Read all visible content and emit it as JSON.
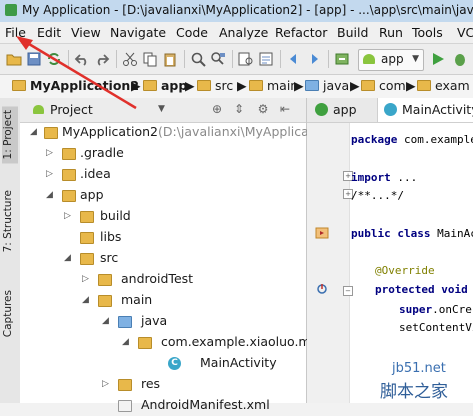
{
  "window": {
    "title": "My Application - [D:\\javalianxi\\MyApplication2] - [app] - ...\\app\\src\\main\\java\\"
  },
  "menu": [
    "File",
    "Edit",
    "View",
    "Navigate",
    "Code",
    "Analyze",
    "Refactor",
    "Build",
    "Run",
    "Tools",
    "VC"
  ],
  "toolbar": {
    "run_config": "app"
  },
  "breadcrumb": [
    "MyApplication2",
    "app",
    "src",
    "main",
    "java",
    "com",
    "exam"
  ],
  "tool_strip": {
    "project_tab": "1: Project",
    "structure_tab": "7: Structure",
    "captures_tab": "Captures"
  },
  "project_panel": {
    "view_selector": "Project",
    "tree": [
      {
        "label": "MyApplication2",
        "extra": "(D:\\javalianxi\\MyApplication"
      },
      {
        "label": ".gradle"
      },
      {
        "label": ".idea"
      },
      {
        "label": "app"
      },
      {
        "label": "build"
      },
      {
        "label": "libs"
      },
      {
        "label": "src"
      },
      {
        "label": "androidTest"
      },
      {
        "label": "main"
      },
      {
        "label": "java"
      },
      {
        "label": "com.example.xiaoluo.mya"
      },
      {
        "label": "MainActivity"
      },
      {
        "label": "res"
      },
      {
        "label": "AndroidManifest.xml"
      }
    ]
  },
  "editor": {
    "tabs": [
      "app",
      "MainActivity"
    ],
    "code": [
      {
        "kw": "package",
        "rest": " com.example"
      },
      {
        "kw": "import",
        "rest": " ..."
      },
      {
        "kw": "",
        "rest": "/**...*/"
      },
      {
        "kw": "public class",
        "rest": " MainAc"
      },
      {
        "kw": "",
        "rest": "@Override"
      },
      {
        "kw": "protected void",
        "rest": ""
      },
      {
        "kw": "super",
        "rest": ".onCre"
      },
      {
        "kw": "",
        "rest": "setContentVi"
      }
    ]
  },
  "watermark": {
    "site": "jb51.net",
    "brand": "脚本之家"
  },
  "colors": {
    "annotation_arrow": "#e0302b",
    "android_green": "#8ac53e",
    "folder": "#e8b84a",
    "source_folder": "#7fb1e3"
  }
}
